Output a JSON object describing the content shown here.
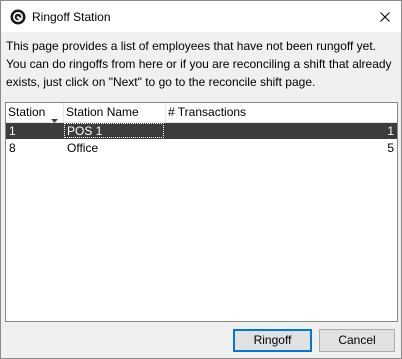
{
  "window": {
    "title": "Ringoff Station",
    "app_icon": "ringoff-logo-icon",
    "close_icon": "close-icon"
  },
  "description": "This page provides a list of employees that have not been rungoff yet. You can do ringoffs from here or if you are reconciling a shift that already exists, just click on \"Next\" to go to the reconcile shift page.",
  "grid": {
    "columns": [
      "Station",
      "Station Name",
      "# Transactions"
    ],
    "sorted_column": "Station",
    "sort_direction": "descending",
    "rows": [
      {
        "station": "1",
        "name": "POS 1",
        "transactions": "1",
        "selected": true
      },
      {
        "station": "8",
        "name": "Office",
        "transactions": "5",
        "selected": false
      }
    ],
    "selected_color": "#3c3c3c"
  },
  "buttons": {
    "ringoff": "Ringoff",
    "cancel": "Cancel"
  },
  "colors": {
    "default_button_border": "#0078d7",
    "button_face": "#e1e1e1",
    "dialog_face": "#f0f0f0"
  }
}
